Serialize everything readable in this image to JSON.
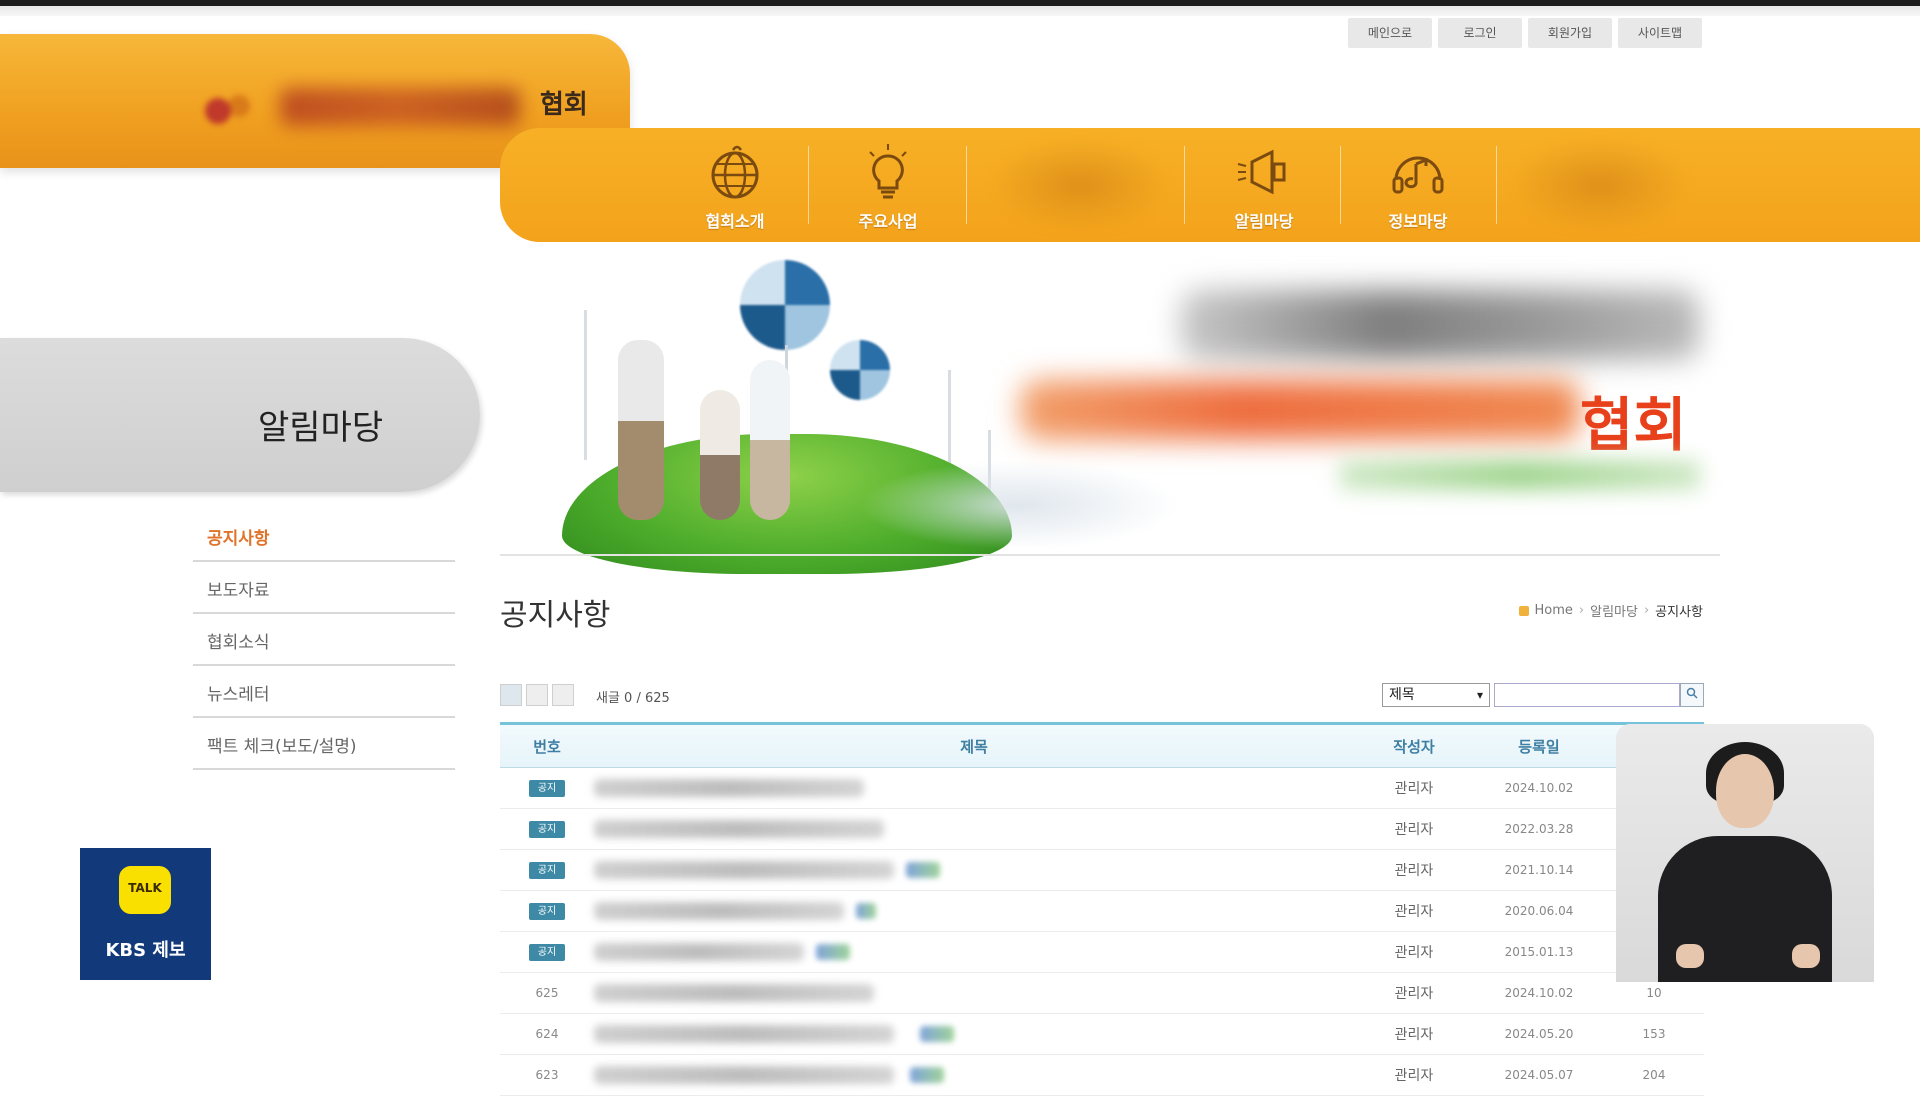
{
  "utility_links": [
    "메인으로",
    "로그인",
    "회원가입",
    "사이트맵"
  ],
  "logo": {
    "suffix": "협회"
  },
  "nav": [
    {
      "label": "협회소개",
      "icon": "globe-icon"
    },
    {
      "label": "주요사업",
      "icon": "lightbulb-icon"
    },
    {
      "label": "",
      "icon": "blurred-icon"
    },
    {
      "label": "알림마당",
      "icon": "megaphone-icon"
    },
    {
      "label": "정보마당",
      "icon": "music-note-icon"
    },
    {
      "label": "",
      "icon": "blurred-icon"
    }
  ],
  "banner": {
    "headline_suffix": "협회"
  },
  "sidebar": {
    "title": "알림마당",
    "items": [
      {
        "label": "공지사항",
        "active": true
      },
      {
        "label": "보도자료",
        "active": false
      },
      {
        "label": "협회소식",
        "active": false
      },
      {
        "label": "뉴스레터",
        "active": false
      },
      {
        "label": "팩트 체크(보도/설명)",
        "active": false
      }
    ]
  },
  "page": {
    "title": "공지사항",
    "breadcrumb": [
      "Home",
      "알림마당",
      "공지사항"
    ]
  },
  "list_toolbar": {
    "count_label": "새글 0 / 625",
    "search_field_selected": "제목",
    "search_placeholder": ""
  },
  "table": {
    "columns": [
      "번호",
      "제목",
      "작성자",
      "등록일"
    ],
    "rows": [
      {
        "no": "공지",
        "author": "관리자",
        "date": "2024.10.02",
        "hits": ""
      },
      {
        "no": "공지",
        "author": "관리자",
        "date": "2022.03.28",
        "hits": ""
      },
      {
        "no": "공지",
        "author": "관리자",
        "date": "2021.10.14",
        "hits": ""
      },
      {
        "no": "공지",
        "author": "관리자",
        "date": "2020.06.04",
        "hits": ""
      },
      {
        "no": "공지",
        "author": "관리자",
        "date": "2015.01.13",
        "hits": ""
      },
      {
        "no": "625",
        "author": "관리자",
        "date": "2024.10.02",
        "hits": "10"
      },
      {
        "no": "624",
        "author": "관리자",
        "date": "2024.05.20",
        "hits": "153"
      },
      {
        "no": "623",
        "author": "관리자",
        "date": "2024.05.07",
        "hits": "204"
      }
    ]
  },
  "overlay": {
    "kbs_talk": "TALK",
    "kbs_label": "KBS 제보"
  },
  "colors": {
    "nav_orange": "#f3a31b",
    "accent_orange": "#e0732a",
    "table_header_blue": "#3f7fa3",
    "notice_badge": "#3e8aa6",
    "kbs_blue": "#123a7a"
  }
}
